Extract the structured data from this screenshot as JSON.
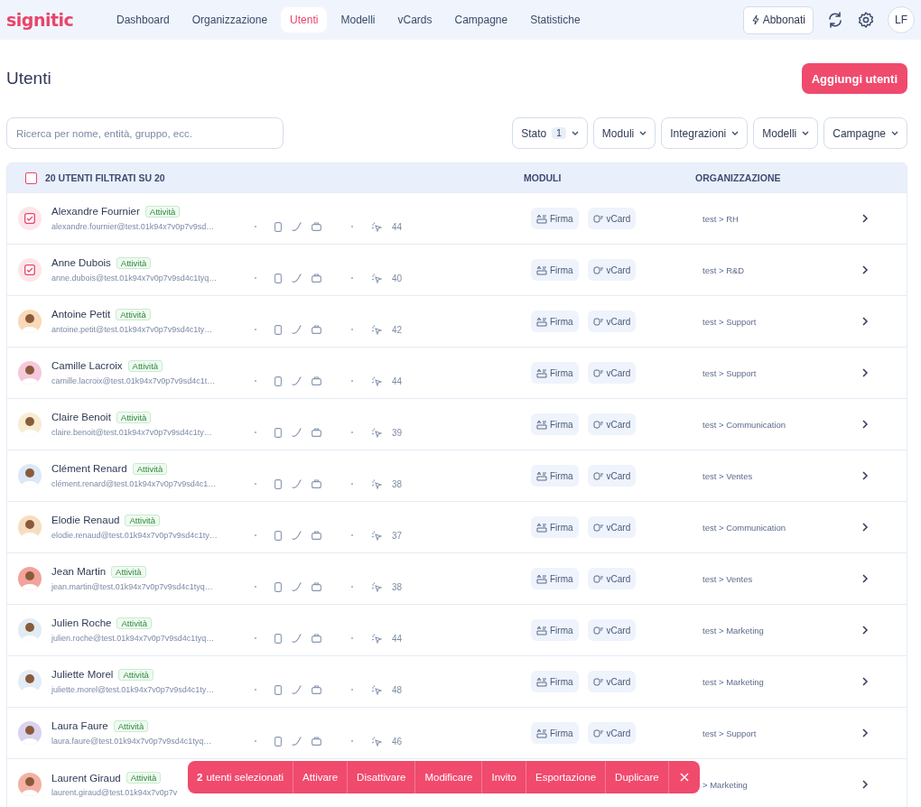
{
  "logo": "signitic",
  "nav": [
    {
      "label": "Dashboard",
      "selected": false
    },
    {
      "label": "Organizzazione",
      "selected": false
    },
    {
      "label": "Utenti",
      "selected": true
    },
    {
      "label": "Modelli",
      "selected": false
    },
    {
      "label": "vCards",
      "selected": false
    },
    {
      "label": "Campagne",
      "selected": false
    },
    {
      "label": "Statistiche",
      "selected": false
    }
  ],
  "subscribe_button": "Abbonati",
  "avatar_initials": "LF",
  "page_title": "Utenti",
  "add_button": "Aggiungi utenti",
  "search": {
    "placeholder": "Ricerca per nome, entità, gruppo, ecc."
  },
  "filters": [
    {
      "label": "Stato",
      "count": "1"
    },
    {
      "label": "Moduli"
    },
    {
      "label": "Integrazioni"
    },
    {
      "label": "Modelli"
    },
    {
      "label": "Campagne"
    }
  ],
  "table": {
    "select_all_checked": false,
    "columns": [
      "20 UTENTI FILTRATI SU 20",
      "MODULI",
      "ORGANIZZAZIONE"
    ],
    "rows": [
      {
        "name": "Alexandre Fournier",
        "status": "Attività",
        "email": "alexandre.fournier@test.01k94x7v0p7v9sd…",
        "count": "44",
        "modules": [
          "Firma",
          "vCard"
        ],
        "org": "test > RH",
        "selected": true
      },
      {
        "name": "Anne Dubois",
        "status": "Attività",
        "email": "anne.dubois@test.01k94x7v0p7v9sd4c1tyq…",
        "count": "40",
        "modules": [
          "Firma",
          "vCard"
        ],
        "org": "test > R&D",
        "selected": true
      },
      {
        "name": "Antoine Petit",
        "status": "Attività",
        "email": "antoine.petit@test.01k94x7v0p7v9sd4c1ty…",
        "count": "42",
        "modules": [
          "Firma",
          "vCard"
        ],
        "org": "test > Support",
        "selected": false,
        "color": "#f9d9b8"
      },
      {
        "name": "Camille Lacroix",
        "status": "Attività",
        "email": "camille.lacroix@test.01k94x7v0p7v9sd4c1t…",
        "count": "44",
        "modules": [
          "Firma",
          "vCard"
        ],
        "org": "test > Support",
        "selected": false,
        "color": "#f6c8dc"
      },
      {
        "name": "Claire Benoit",
        "status": "Attività",
        "email": "claire.benoit@test.01k94x7v0p7v9sd4c1ty…",
        "count": "39",
        "modules": [
          "Firma",
          "vCard"
        ],
        "org": "test > Communication",
        "selected": false,
        "color": "#f7ecd2"
      },
      {
        "name": "Clément Renard",
        "status": "Attività",
        "email": "clément.renard@test.01k94x7v0p7v9sd4c1…",
        "count": "38",
        "modules": [
          "Firma",
          "vCard"
        ],
        "org": "test > Ventes",
        "selected": false,
        "color": "#dce8f7"
      },
      {
        "name": "Elodie Renaud",
        "status": "Attività",
        "email": "elodie.renaud@test.01k94x7v0p7v9sd4c1ty…",
        "count": "37",
        "modules": [
          "Firma",
          "vCard"
        ],
        "org": "test > Communication",
        "selected": false,
        "color": "#f7ddc0"
      },
      {
        "name": "Jean Martin",
        "status": "Attività",
        "email": "jean.martin@test.01k94x7v0p7v9sd4c1tyq…",
        "count": "38",
        "modules": [
          "Firma",
          "vCard"
        ],
        "org": "test > Ventes",
        "selected": false,
        "color": "#f2a39c"
      },
      {
        "name": "Julien Roche",
        "status": "Attività",
        "email": "julien.roche@test.01k94x7v0p7v9sd4c1tyq…",
        "count": "44",
        "modules": [
          "Firma",
          "vCard"
        ],
        "org": "test > Marketing",
        "selected": false,
        "color": "#e3ebf2"
      },
      {
        "name": "Juliette Morel",
        "status": "Attività",
        "email": "juliette.morel@test.01k94x7v0p7v9sd4c1ty…",
        "count": "48",
        "modules": [
          "Firma",
          "vCard"
        ],
        "org": "test > Marketing",
        "selected": false,
        "color": "#e4ecf6"
      },
      {
        "name": "Laura Faure",
        "status": "Attività",
        "email": "laura.faure@test.01k94x7v0p7v9sd4c1tyq…",
        "count": "46",
        "modules": [
          "Firma",
          "vCard"
        ],
        "org": "test > Support",
        "selected": false,
        "color": "#d9d3ee"
      },
      {
        "name": "Laurent Giraud",
        "status": "Attività",
        "email": "laurent.giraud@test.01k94x7v0p7v",
        "org": "> Marketing",
        "selected": false,
        "color": "#f4b0a4"
      }
    ]
  },
  "selection_bar": {
    "count": "2",
    "label": "utenti selezionati",
    "actions": [
      "Attivare",
      "Disattivare",
      "Modificare",
      "Invito",
      "Esportazione",
      "Duplicare"
    ]
  }
}
